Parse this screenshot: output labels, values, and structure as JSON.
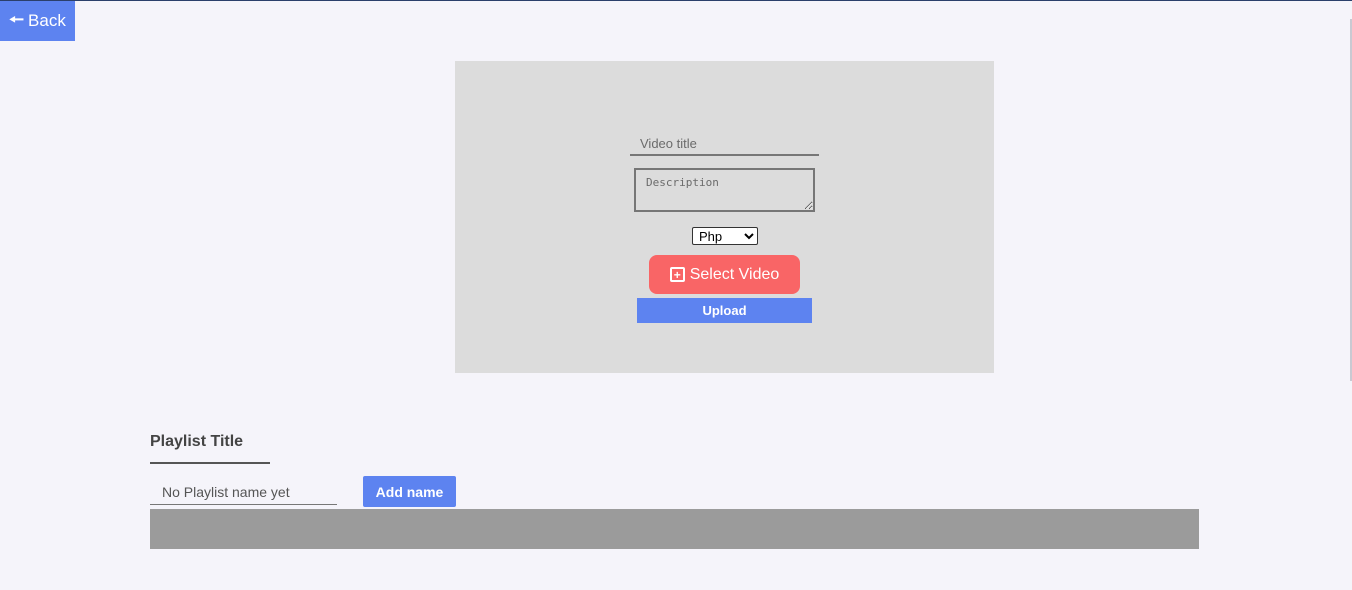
{
  "header": {
    "back_label": "Back",
    "back_icon": "arrow-left-icon"
  },
  "upload_form": {
    "title_placeholder": "Video title",
    "description_placeholder": "Description",
    "category_selected": "Php",
    "select_video_label": "Select Video",
    "select_video_icon": "plus-square-icon",
    "upload_label": "Upload"
  },
  "playlist": {
    "heading": "Playlist Title",
    "name_placeholder": "No Playlist name yet",
    "add_name_label": "Add name"
  },
  "colors": {
    "primary": "#5d83f0",
    "select_video": "#f96566",
    "panel": "#dcdcdc",
    "playlist_bar": "#9b9b9b",
    "background": "#f5f4fa"
  }
}
